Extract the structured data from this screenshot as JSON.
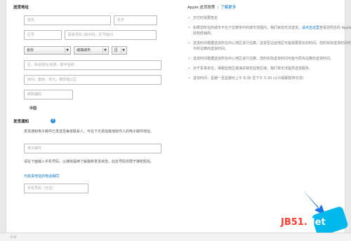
{
  "shipping": {
    "title": "送货地址",
    "last_name_placeholder": "姓氏",
    "first_name_placeholder": "名字",
    "area_code_placeholder": "区号",
    "phone_placeholder": "联系号码 (如手机，区号输O)",
    "province_select": "省份",
    "city_select": "城填城市",
    "district_select": "区",
    "street_placeholder": "区，街道地址/名称，楼宇名称",
    "room_placeholder": "房间，套房，单元，楼层或公区",
    "postcode_placeholder": "邮政编码",
    "country": "中国"
  },
  "notification": {
    "title": "发货通知",
    "help_icon": "?",
    "email_desc": "发货通知电子邮件已发送至每单联系人。可在下方添加其他收件人的电子邮件地址。",
    "email_placeholder": "电子邮件",
    "mobile_desc": "请在下面输入手机号码，以接收提续了解最新发货状态。此处号码仅限于接收短信。",
    "link": "与收货地址的电话相同",
    "mobile_placeholder": "手机号码（可选）"
  },
  "policy": {
    "title": "Apple 送货政策",
    "learn_more": "了解更多",
    "bullets": [
      {
        "text": "交付时需要签名"
      },
      {
        "text": "如果您所在的城市不在下拉菜单中的城市范围内，我们目前无法送货。请点击这里查看您附近的 Apple 授权经销商。",
        "link": "请点击这里"
      },
      {
        "text": "送货时间根据送货所在中心地区进行估算。送货至边远地区可能需要更长的时间。您的实际送货时间可能与所估算的送货时间。"
      },
      {
        "text": "送货时间根据送货所在中心地区进行估算。您的实际送货时间可能与原先估算的送货时间。"
      },
      {
        "text": "对于军事单位，保税监管区或海关特定监管区域，我们将无法提供送货服务。"
      },
      {
        "text": "送货时间：星期一至星期日上午 8:30 至下午 5:30 (公众假期暂停交货)"
      }
    ]
  },
  "watermark": {
    "text": "JB51",
    "dot": ".",
    "net": "Net"
  },
  "footer": {
    "text": "小计"
  },
  "colors": {
    "link": "#0070c9",
    "help": "#2a8fe0",
    "cursor": "#1a73e8",
    "watermark": "#ff3b30"
  }
}
